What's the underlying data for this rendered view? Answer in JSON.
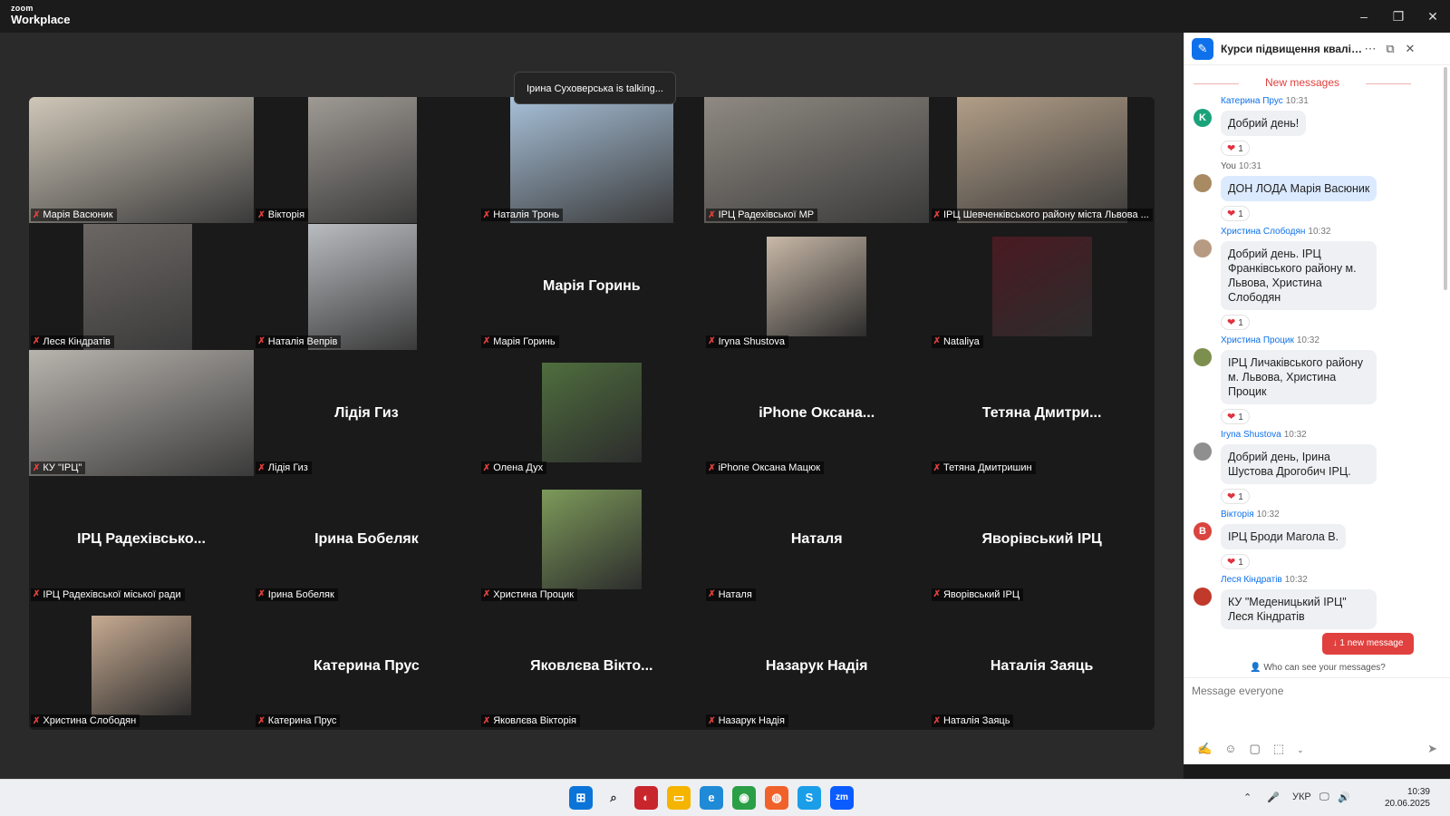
{
  "app": {
    "logo_top": "zoom",
    "logo_bottom": "Workplace"
  },
  "window_buttons": {
    "minimize": "–",
    "restore": "❐",
    "close": "✕"
  },
  "talking_indicator": "Ірина Суховерська is talking...",
  "participants": [
    {
      "label": "Марія Васюник",
      "video": true,
      "bg": "#cfc7b8"
    },
    {
      "label": "Вікторія",
      "video": true,
      "bg": "#9f9a94"
    },
    {
      "label": "Наталія Тронь",
      "video": true,
      "bg": "#a7c0d8"
    },
    {
      "label": "ІРЦ Радехівської МР",
      "video": true,
      "bg": "#8f8a82"
    },
    {
      "label": "ІРЦ Шевченківського району міста Львова ...",
      "video": true,
      "bg": "#b29e87"
    },
    {
      "label": "Леся Кіндратів",
      "video": true,
      "bg": "#6c6764"
    },
    {
      "label": "Наталія Вепрів",
      "video": true,
      "bg": "#b9bcc0"
    },
    {
      "label": "Марія Горинь",
      "name": "Марія Горинь",
      "video": false
    },
    {
      "label": "Iryna Shustova",
      "thumb": true,
      "bg": "#c9b9a8"
    },
    {
      "label": "Nataliya",
      "thumb": true,
      "bg": "#4a1a22"
    },
    {
      "label": "КУ \"ІРЦ\"",
      "video": true,
      "bg": "#b8b4ae"
    },
    {
      "label": "Лідія Гиз",
      "name": "Лідія Гиз",
      "video": false
    },
    {
      "label": "Олена Дух",
      "thumb": true,
      "bg": "#4f6e3e"
    },
    {
      "label": "iPhone Оксана Мацюк",
      "name": "iPhone Оксана...",
      "video": false
    },
    {
      "label": "Тетяна Дмитришин",
      "name": "Тетяна Дмитри...",
      "video": false
    },
    {
      "label": "ІРЦ Радехівської міської ради",
      "name": "ІРЦ Радехівсько...",
      "video": false
    },
    {
      "label": "Ірина Бобеляк",
      "name": "Ірина Бобеляк",
      "video": false
    },
    {
      "label": "Христина Процик",
      "thumb": true,
      "bg": "#7d9a5a"
    },
    {
      "label": "Наталя",
      "name": "Наталя",
      "video": false
    },
    {
      "label": "Яворівський ІРЦ",
      "name": "Яворівський ІРЦ",
      "video": false
    },
    {
      "label": "Христина Слободян",
      "thumb": true,
      "bg": "#c7ab92"
    },
    {
      "label": "Катерина Прус",
      "name": "Катерина Прус",
      "video": false
    },
    {
      "label": "Яковлєва Вікторія",
      "name": "Яковлєва Вікто...",
      "video": false
    },
    {
      "label": "Назарук Надія",
      "name": "Назарук Надія",
      "video": false
    },
    {
      "label": "Наталія Заяць",
      "name": "Наталія Заяць",
      "video": false
    }
  ],
  "chat": {
    "title": "Курси підвищення кваліфі...",
    "new_messages": "New messages",
    "new_message_button": "↓  1 new message",
    "who_can_see": "Who can see your messages?",
    "compose_placeholder": "Message everyone",
    "messages": [
      {
        "sender": "Катерина Прус",
        "time": "10:31",
        "text": "Добрий день!",
        "reaction": "1",
        "avatar": "K",
        "avatar_color": "#1aa37a"
      },
      {
        "sender": "You",
        "time": "10:31",
        "text": "ДОН ЛОДА Марія Васюник",
        "reaction": "1",
        "avatar": "",
        "avatar_color": "#a88a63",
        "mine": true
      },
      {
        "sender": "Христина Слободян",
        "time": "10:32",
        "text": "Добрий день. ІРЦ Франківського району м. Львова, Христина Слободян",
        "reaction": "1",
        "avatar": "",
        "avatar_color": "#b79a82"
      },
      {
        "sender": "Христина Процик",
        "time": "10:32",
        "text": "ІРЦ Личаківського району м. Львова, Христина Процик",
        "reaction": "1",
        "avatar": "",
        "avatar_color": "#7d8f4e"
      },
      {
        "sender": "Iryna Shustova",
        "time": "10:32",
        "text": "Добрий день, Ірина Шустова Дрогобич ІРЦ.",
        "reaction": "1",
        "avatar": "",
        "avatar_color": "#8f8f8f"
      },
      {
        "sender": "Вікторія",
        "time": "10:32",
        "text": "ІРЦ Броди Магола В.",
        "reaction": "1",
        "avatar": "В",
        "avatar_color": "#d9443e"
      },
      {
        "sender": "Леся Кіндратів",
        "time": "10:32",
        "text": "КУ \"Меденицький ІРЦ\" Леся Кіндратів",
        "reaction": "",
        "avatar": "",
        "avatar_color": "#c0392b"
      }
    ]
  },
  "taskbar": {
    "language": "УКР",
    "time": "10:39",
    "date": "20.06.2025"
  }
}
